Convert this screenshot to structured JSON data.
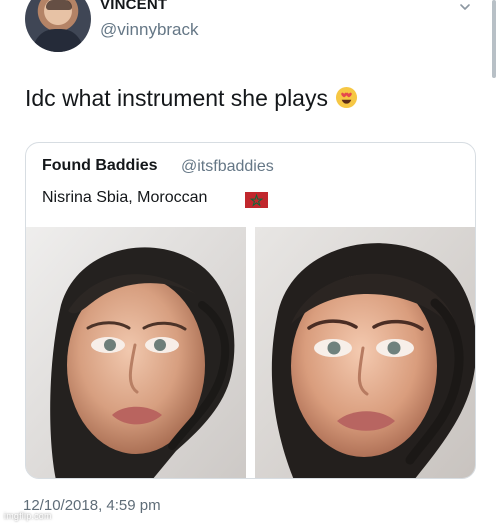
{
  "tweet": {
    "author": {
      "display_name": "VINCENT",
      "handle": "@vinnybrack"
    },
    "text": "Idc what instrument she plays",
    "emoji": "smiling-face-with-heart-eyes",
    "timestamp": "12/10/2018, 4:59 pm"
  },
  "quoted_tweet": {
    "display_name": "Found Baddies",
    "handle": "@itsfbaddies",
    "text": "Nisrina Sbia, Moroccan",
    "flag": "morocco-flag",
    "images": [
      "portrait-photo",
      "portrait-photo"
    ]
  },
  "watermark": "imgflip.com",
  "icons": {
    "menu": "chevron-down-icon"
  },
  "colors": {
    "text_primary": "#14171a",
    "text_secondary": "#657786",
    "border": "#d7dde2",
    "flag_red": "#c1272d"
  }
}
